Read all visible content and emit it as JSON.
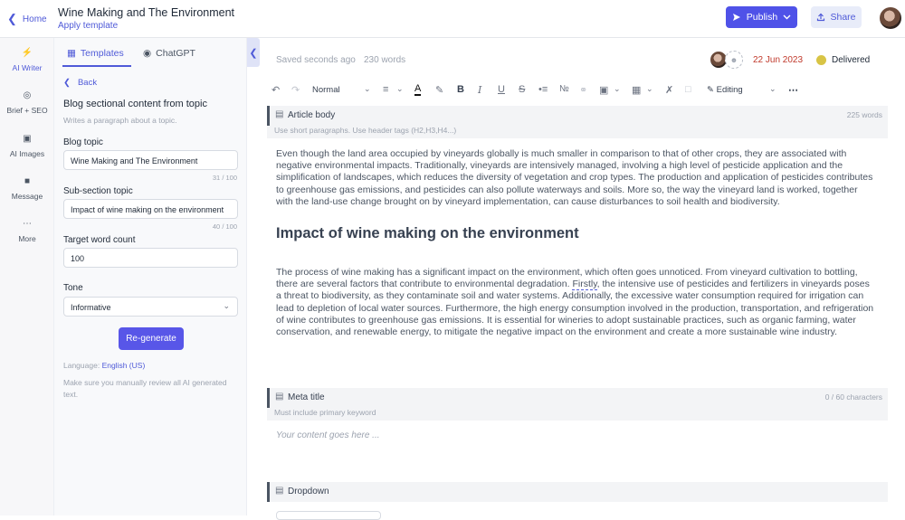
{
  "topbar": {
    "home_label": "Home",
    "doc_title": "Wine Making and The Environment",
    "apply_template": "Apply template",
    "publish_label": "Publish",
    "share_label": "Share"
  },
  "rail": {
    "items": [
      {
        "label": "AI Writer",
        "icon": "bolt-icon"
      },
      {
        "label": "Brief + SEO",
        "icon": "target-icon"
      },
      {
        "label": "AI Images",
        "icon": "image-icon"
      },
      {
        "label": "Message",
        "icon": "chat-icon"
      },
      {
        "label": "More",
        "icon": "dots-icon"
      }
    ]
  },
  "panel": {
    "tabs": [
      {
        "label": "Templates"
      },
      {
        "label": "ChatGPT"
      }
    ],
    "back_label": "Back",
    "heading": "Blog sectional content from topic",
    "subheading": "Writes a paragraph about a topic.",
    "blog_topic": {
      "label": "Blog topic",
      "value": "Wine Making and The Environment",
      "count": "31 / 100"
    },
    "sub_section": {
      "label": "Sub-section topic",
      "value": "Impact of wine making on the environment",
      "count": "40 / 100"
    },
    "target_words": {
      "label": "Target word count",
      "value": "100"
    },
    "tone": {
      "label": "Tone",
      "value": "Informative"
    },
    "regenerate_label": "Re-generate",
    "language_prefix": "Language:",
    "language_value": "English (US)",
    "warning": "Make sure you manually review all AI generated text."
  },
  "status": {
    "saved": "Saved seconds ago",
    "words": "230 words",
    "date": "22 Jun 2023",
    "state": "Delivered",
    "state_color": "#d8c445"
  },
  "toolbar": {
    "format": "Normal",
    "mode": "Editing"
  },
  "article": {
    "title": "Article body",
    "word_count": "225 words",
    "hint": "Use short paragraphs. Use header tags (H2,H3,H4...)",
    "para1": "Even though the land area occupied by vineyards globally is much smaller in comparison to that of other crops, they are associated with negative environmental impacts. Traditionally, vineyards are intensively managed, involving a high level of pesticide application and the simplification of landscapes, which reduces the diversity of vegetation and crop types. The production and application of pesticides contributes to greenhouse gas emissions, and pesticides can also pollute waterways and soils. More so, the way the vineyard land is worked, together with the land-use change brought on by vineyard implementation, can cause disturbances to soil health and biodiversity.",
    "heading": "Impact of wine making on the environment",
    "para2_a": "The process of wine making has a significant impact on the environment, which often goes unnoticed. From vineyard cultivation to bottling, there are several factors that contribute to environmental degradation.",
    "para2_word": "Firstly",
    "para2_b": ", the intensive use of pesticides and fertilizers in vineyards poses a threat to biodiversity, as they contaminate soil and water systems. Additionally, the excessive water consumption required for irrigation can lead to depletion of local water sources. Furthermore, the high energy consumption involved in the production, transportation, and refrigeration of wine contributes to greenhouse gas emissions. It is essential for wineries to adopt sustainable practices, such as organic farming, water conservation, and renewable energy, to mitigate the negative impact on the environment and create a more sustainable wine industry."
  },
  "meta": {
    "title": "Meta title",
    "count": "0 / 60 characters",
    "hint": "Must include primary keyword",
    "placeholder": "Your content goes here ..."
  },
  "dropdown": {
    "title": "Dropdown"
  }
}
